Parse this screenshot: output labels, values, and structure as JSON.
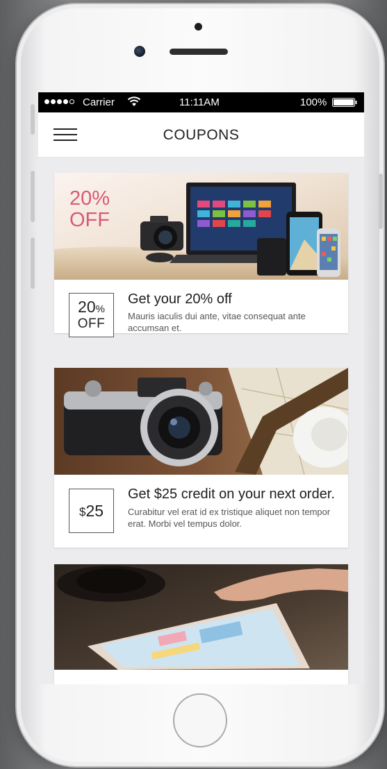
{
  "status_bar": {
    "carrier": "Carrier",
    "time": "11:11AM",
    "battery": "100%"
  },
  "nav": {
    "title": "COUPONS"
  },
  "coupons": [
    {
      "image_pct": "20%",
      "image_off": "OFF",
      "badge_pct": "20",
      "badge_pct_sign": "%",
      "badge_off": "OFF",
      "title": "Get your 20% off",
      "description": "Mauris iaculis dui ante, vitae consequat ante accumsan et."
    },
    {
      "badge_dollar": "$",
      "badge_amount": "25",
      "title": "Get $25 credit on your next order.",
      "description": "Curabitur vel erat id ex tristique aliquet non tempor erat. Morbi vel tempus dolor."
    }
  ],
  "colors": {
    "accent_pink": "#d85a73",
    "screen_bg": "#ececee",
    "status_bar_bg": "#000000"
  }
}
